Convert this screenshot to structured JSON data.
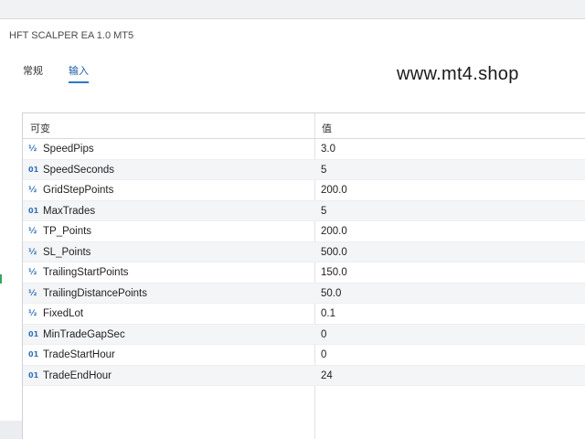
{
  "window": {
    "title": "HFT SCALPER EA 1.0 MT5"
  },
  "tabs": [
    {
      "label": "常规"
    },
    {
      "label": "输入"
    }
  ],
  "watermark": "www.mt4.shop",
  "grid": {
    "headers": {
      "variable": "可变",
      "value": "值"
    },
    "rows": [
      {
        "icon": "double-type-icon",
        "name": "SpeedPips",
        "value": "3.0"
      },
      {
        "icon": "int-type-icon",
        "name": "SpeedSeconds",
        "value": "5"
      },
      {
        "icon": "double-type-icon",
        "name": "GridStepPoints",
        "value": "200.0"
      },
      {
        "icon": "int-type-icon",
        "name": "MaxTrades",
        "value": "5"
      },
      {
        "icon": "double-type-icon",
        "name": "TP_Points",
        "value": "200.0"
      },
      {
        "icon": "double-type-icon",
        "name": "SL_Points",
        "value": "500.0"
      },
      {
        "icon": "double-type-icon",
        "name": "TrailingStartPoints",
        "value": "150.0"
      },
      {
        "icon": "double-type-icon",
        "name": "TrailingDistancePoints",
        "value": "50.0"
      },
      {
        "icon": "double-type-icon",
        "name": "FixedLot",
        "value": "0.1"
      },
      {
        "icon": "int-type-icon",
        "name": "MinTradeGapSec",
        "value": "0"
      },
      {
        "icon": "int-type-icon",
        "name": "TradeStartHour",
        "value": "0"
      },
      {
        "icon": "int-type-icon",
        "name": "TradeEndHour",
        "value": "24"
      }
    ]
  },
  "colors": {
    "accent": "#2b79c9",
    "icon": "#2d6fb8"
  }
}
